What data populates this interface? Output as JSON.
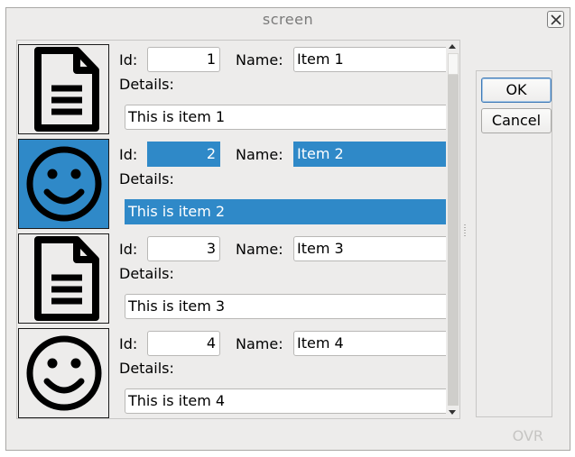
{
  "window": {
    "title": "screen",
    "status": "OVR"
  },
  "labels": {
    "id": "Id:",
    "name": "Name:",
    "details": "Details:"
  },
  "items": [
    {
      "icon": "document-icon",
      "id": "1",
      "name": "Item 1",
      "details": "This is item 1",
      "selected": false
    },
    {
      "icon": "smiley-icon",
      "id": "2",
      "name": "Item 2",
      "details": "This is item 2",
      "selected": true
    },
    {
      "icon": "document-icon",
      "id": "3",
      "name": "Item 3",
      "details": "This is item 3",
      "selected": false
    },
    {
      "icon": "smiley-icon",
      "id": "4",
      "name": "Item 4",
      "details": "This is item 4",
      "selected": false
    }
  ],
  "buttons": {
    "ok": "OK",
    "cancel": "Cancel"
  },
  "colors": {
    "selection": "#2f89c8",
    "window_bg": "#edeceb"
  }
}
